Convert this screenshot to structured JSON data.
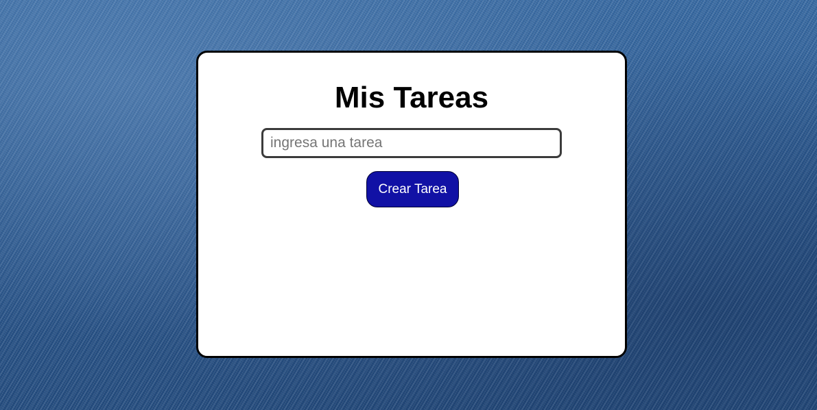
{
  "app": {
    "title": "Mis Tareas"
  },
  "task_form": {
    "input_value": "",
    "input_placeholder": "ingresa una tarea",
    "create_button_label": "Crear Tarea"
  },
  "colors": {
    "button_background": "#1111a5",
    "card_background": "#ffffff",
    "page_background": "#2f5b8d"
  }
}
